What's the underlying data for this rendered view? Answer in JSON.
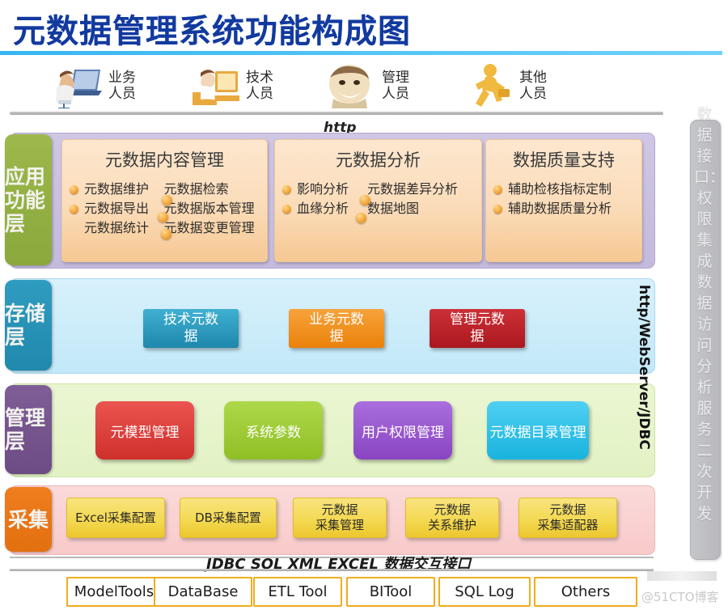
{
  "title": "元数据管理系统功能构成图",
  "actors": [
    {
      "label1": "业务",
      "label2": "人员",
      "icon": "business-person-icon"
    },
    {
      "label1": "技术",
      "label2": "人员",
      "icon": "technical-person-icon"
    },
    {
      "label1": "管理",
      "label2": "人员",
      "icon": "management-person-icon"
    },
    {
      "label1": "其他",
      "label2": "人员",
      "icon": "other-person-icon"
    }
  ],
  "protocol_top": "http",
  "protocol_vertical": "http/WebServer/JDBC",
  "layers": {
    "application": {
      "tab_label": "应用功能层",
      "tab_color": "#9db84b",
      "boxes": [
        {
          "title": "元数据内容管理",
          "col_left": [
            "元数据维护",
            "元数据导出",
            "元数据统计"
          ],
          "col_right": [
            "元数据检索",
            "元数据版本管理",
            "元数据变更管理"
          ]
        },
        {
          "title": "元数据分析",
          "col_left": [
            "影响分析",
            "血缘分析"
          ],
          "col_right": [
            "元数据差异分析",
            "数据地图"
          ]
        },
        {
          "title": "数据质量支持",
          "col_left": [
            "辅助检核指标定制",
            "辅助数据质量分析"
          ],
          "col_right": []
        }
      ]
    },
    "storage": {
      "tab_label": "存储层",
      "tab_color": "#2e9cc0",
      "boxes": [
        {
          "label1": "技术元数",
          "label2": "据",
          "color": "#2e9cc0"
        },
        {
          "label1": "业务元数",
          "label2": "据",
          "color": "#ef8b13"
        },
        {
          "label1": "管理元数",
          "label2": "据",
          "color": "#bb2026"
        }
      ]
    },
    "management": {
      "tab_label": "管理层",
      "tab_color": "#7f5d96",
      "boxes": [
        {
          "label": "元模型管理",
          "color": "#e0413c"
        },
        {
          "label": "系统参数",
          "color": "#9fcd36"
        },
        {
          "label": "用户权限管理",
          "color": "#9b59d0"
        },
        {
          "label": "元数据目录管理",
          "color": "#2fc0e8"
        }
      ]
    },
    "collection": {
      "tab_label": "采集",
      "tab_color": "#f07d1e",
      "boxes": [
        {
          "line1": "Excel采集配置",
          "line2": ""
        },
        {
          "line1": "DB采集配置",
          "line2": ""
        },
        {
          "line1": "元数据",
          "line2": "采集管理"
        },
        {
          "line1": "元数据",
          "line2": "关系维护"
        },
        {
          "line1": "元数据",
          "line2": "采集适配器"
        }
      ]
    }
  },
  "interface_label": "JDBC SQL XML EXCEL 数据交互接口",
  "sources": [
    "ModelTools",
    "DataBase",
    "ETL Tool",
    "BITool",
    "SQL Log",
    "Others"
  ],
  "right_sidebar": "数据接口：权限集成 数据访问 分析服务 二次开发",
  "watermark": "@51CTO博客"
}
